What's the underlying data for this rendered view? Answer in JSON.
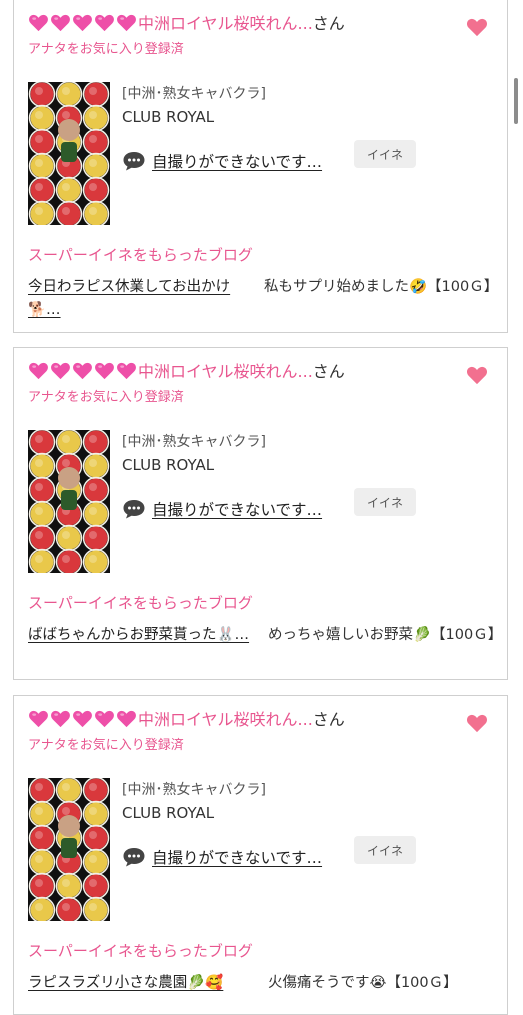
{
  "colors": {
    "accent_pink": "#e8568f",
    "heart_pink": "#ee4fa8",
    "border": "#cfcfcf"
  },
  "cards": [
    {
      "name": "中洲ロイヤル桜咲れん...",
      "san": "さん",
      "fav_status": "アナタをお気に入り登録済",
      "category": "[中洲･熟女キャバクラ]",
      "club": "CLUB ROYAL",
      "chat_text": "自撮りができないです…",
      "iine_label": "イイネ",
      "section_label": "スーパーイイネをもらったブログ",
      "blog_title": "今日わラピス休業してお出かけ🐕…",
      "blog_desc": "私もサプリ始めました🤣【100Ｇ】"
    },
    {
      "name": "中洲ロイヤル桜咲れん...",
      "san": "さん",
      "fav_status": "アナタをお気に入り登録済",
      "category": "[中洲･熟女キャバクラ]",
      "club": "CLUB ROYAL",
      "chat_text": "自撮りができないです…",
      "iine_label": "イイネ",
      "section_label": "スーパーイイネをもらったブログ",
      "blog_title": "ばばちゃんからお野菜貰った🐰…",
      "blog_desc": "めっちゃ嬉しいお野菜🥬【100Ｇ】"
    },
    {
      "name": "中洲ロイヤル桜咲れん...",
      "san": "さん",
      "fav_status": "アナタをお気に入り登録済",
      "category": "[中洲･熟女キャバクラ]",
      "club": "CLUB ROYAL",
      "chat_text": "自撮りができないです…",
      "iine_label": "イイネ",
      "section_label": "スーパーイイネをもらったブログ",
      "blog_title": "ラピスラズリ小さな農園🥬🥰",
      "blog_desc": "火傷痛そうです😭【100Ｇ】"
    }
  ],
  "icons": {
    "name_hearts": "pink-heart-icon",
    "favorite": "heart-icon",
    "chat": "speech-bubble-icon"
  }
}
